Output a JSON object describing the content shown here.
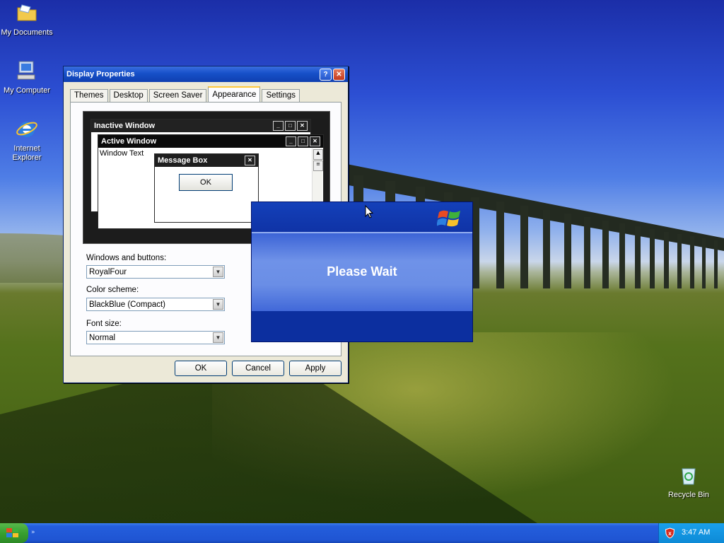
{
  "desktop": {
    "icons": [
      {
        "label": "My Documents",
        "icon": "folder-icon"
      },
      {
        "label": "My Computer",
        "icon": "computer-icon"
      },
      {
        "label": "Internet Explorer",
        "icon": "internet-explorer-icon"
      },
      {
        "label": "Recycle Bin",
        "icon": "recycle-bin-icon"
      }
    ]
  },
  "window": {
    "title": "Display Properties",
    "tabs": [
      "Themes",
      "Desktop",
      "Screen Saver",
      "Appearance",
      "Settings"
    ],
    "active_tab": "Appearance",
    "preview": {
      "inactive_title": "Inactive Window",
      "active_title": "Active Window",
      "window_text": "Window Text",
      "message_box_title": "Message Box",
      "ok_label": "OK"
    },
    "windows_and_buttons": {
      "label": "Windows and buttons:",
      "value": "RoyalFour"
    },
    "color_scheme": {
      "label": "Color scheme:",
      "value": "BlackBlue (Compact)"
    },
    "font_size": {
      "label": "Font size:",
      "value": "Normal"
    },
    "buttons": {
      "ok": "OK",
      "cancel": "Cancel",
      "apply": "Apply"
    }
  },
  "wait_dialog": {
    "message": "Please Wait"
  },
  "taskbar": {
    "clock": "3:47 AM"
  },
  "colors": {
    "xp_blue": "#0b2d9c",
    "taskbar_blue": "#245edc",
    "start_green": "#38a02f"
  }
}
